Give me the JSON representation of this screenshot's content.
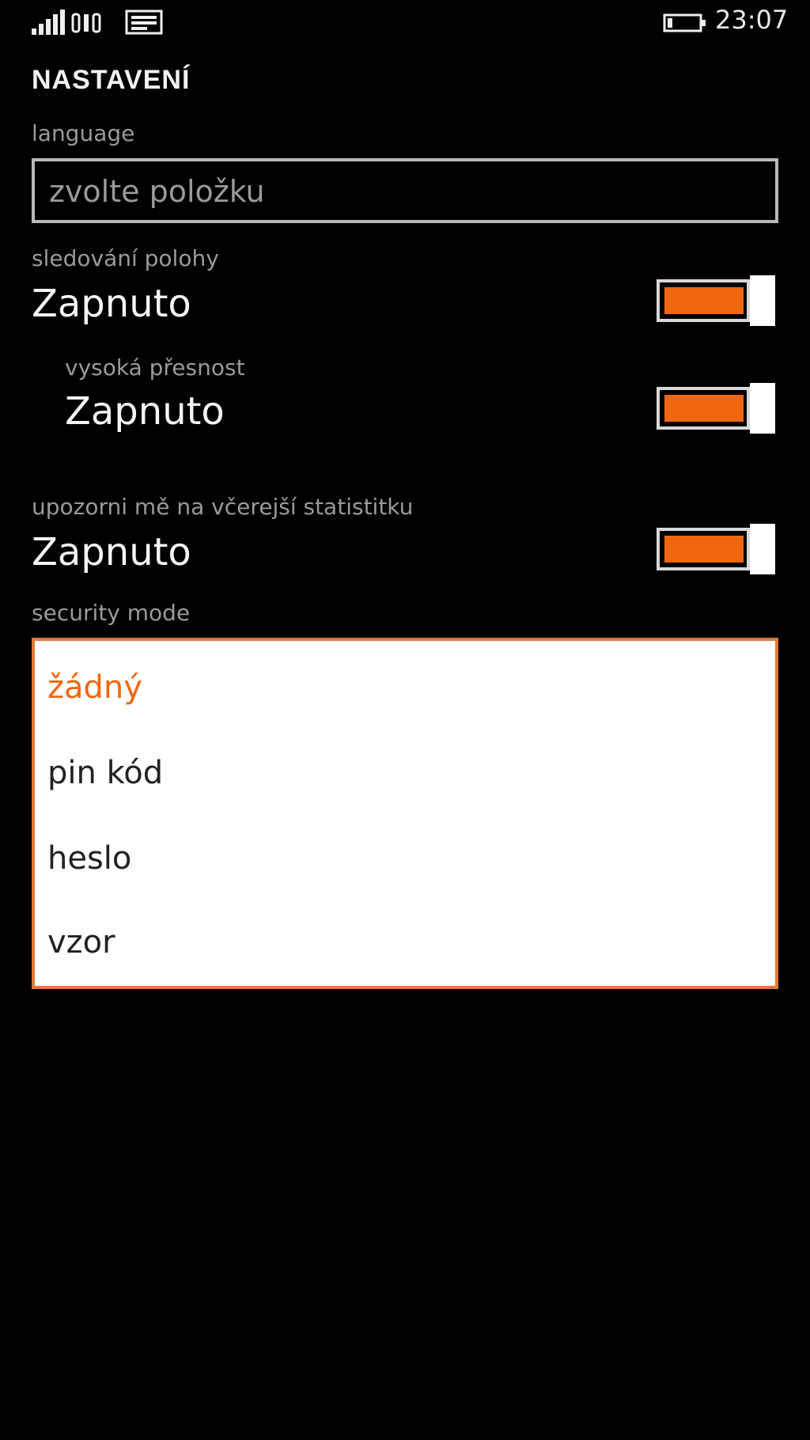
{
  "status_bar": {
    "time": "23:07",
    "signal_icon": "signal-bars-icon",
    "message_icon": "message-icon",
    "battery_icon": "battery-icon"
  },
  "page": {
    "title": "NASTAVENÍ"
  },
  "language": {
    "label": "language",
    "placeholder": "zvolte položku"
  },
  "location_tracking": {
    "label": "sledování polohy",
    "value": "Zapnuto",
    "on": true
  },
  "high_accuracy": {
    "label": "vysoká přesnost",
    "value": "Zapnuto",
    "on": true
  },
  "notify_stats": {
    "label": "upozorni mě na včerejší statistitku",
    "value": "Zapnuto",
    "on": true
  },
  "security_mode": {
    "label": "security mode",
    "options": [
      "žádný",
      "pin kód",
      "heslo",
      "vzor"
    ],
    "selected": "žádný"
  },
  "colors": {
    "accent": "#f0670f",
    "background": "#000000"
  }
}
